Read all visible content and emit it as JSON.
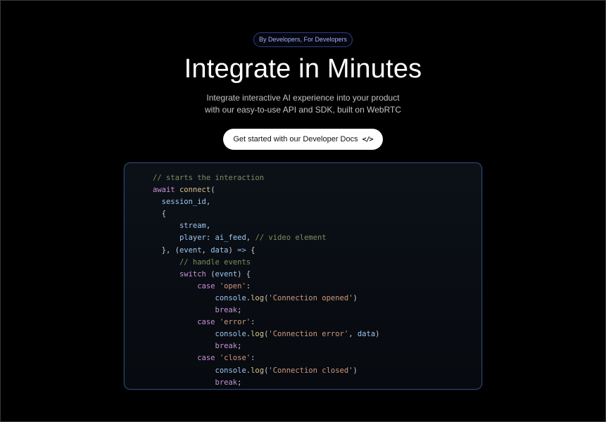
{
  "hero": {
    "badge": "By Developers, For Developers",
    "title": "Integrate in Minutes",
    "subtitle_line1": "Integrate interactive AI experience into your product",
    "subtitle_line2": "with our easy-to-use API and SDK, built on WebRTC",
    "cta_label": "Get started with our Developer Docs",
    "cta_icon": "code-icon"
  },
  "colors": {
    "background": "#000000",
    "badge_border": "#2f3f86",
    "badge_text": "#9fb2ff",
    "cta_background": "#ffffff",
    "code_panel_border": "#2e4a6e",
    "comment": "#7b8f5e",
    "keyword": "#c792d6",
    "string": "#d09a7e",
    "variable": "#9ec7f0"
  },
  "code": {
    "lines": [
      [
        {
          "t": "// starts the interaction",
          "k": "comment"
        }
      ],
      [
        {
          "t": "await ",
          "k": "keyword"
        },
        {
          "t": "connect",
          "k": "fn"
        },
        {
          "t": "(",
          "k": "punc"
        }
      ],
      [
        {
          "t": "  ",
          "k": "punc"
        },
        {
          "t": "session_id",
          "k": "var"
        },
        {
          "t": ",",
          "k": "punc"
        }
      ],
      [
        {
          "t": "  {",
          "k": "punc"
        }
      ],
      [
        {
          "t": "      ",
          "k": "punc"
        },
        {
          "t": "stream",
          "k": "var"
        },
        {
          "t": ",",
          "k": "punc"
        }
      ],
      [
        {
          "t": "      ",
          "k": "punc"
        },
        {
          "t": "player",
          "k": "var"
        },
        {
          "t": ": ",
          "k": "punc"
        },
        {
          "t": "ai_feed",
          "k": "var"
        },
        {
          "t": ", ",
          "k": "punc"
        },
        {
          "t": "// video element",
          "k": "comment"
        }
      ],
      [
        {
          "t": "  }, (",
          "k": "punc"
        },
        {
          "t": "event",
          "k": "var"
        },
        {
          "t": ", ",
          "k": "punc"
        },
        {
          "t": "data",
          "k": "var"
        },
        {
          "t": ") ",
          "k": "punc"
        },
        {
          "t": "=>",
          "k": "op"
        },
        {
          "t": " {",
          "k": "punc"
        }
      ],
      [
        {
          "t": "      ",
          "k": "punc"
        },
        {
          "t": "// handle events",
          "k": "comment"
        }
      ],
      [
        {
          "t": "      ",
          "k": "punc"
        },
        {
          "t": "switch",
          "k": "keyword"
        },
        {
          "t": " (",
          "k": "punc"
        },
        {
          "t": "event",
          "k": "var"
        },
        {
          "t": ") {",
          "k": "punc"
        }
      ],
      [
        {
          "t": "          ",
          "k": "punc"
        },
        {
          "t": "case",
          "k": "keyword"
        },
        {
          "t": " ",
          "k": "punc"
        },
        {
          "t": "'open'",
          "k": "str"
        },
        {
          "t": ":",
          "k": "punc"
        }
      ],
      [
        {
          "t": "              ",
          "k": "punc"
        },
        {
          "t": "console",
          "k": "var"
        },
        {
          "t": ".",
          "k": "punc"
        },
        {
          "t": "log",
          "k": "fn"
        },
        {
          "t": "(",
          "k": "punc"
        },
        {
          "t": "'Connection opened'",
          "k": "str"
        },
        {
          "t": ")",
          "k": "punc"
        }
      ],
      [
        {
          "t": "              ",
          "k": "punc"
        },
        {
          "t": "break",
          "k": "keyword"
        },
        {
          "t": ";",
          "k": "punc"
        }
      ],
      [
        {
          "t": "          ",
          "k": "punc"
        },
        {
          "t": "case",
          "k": "keyword"
        },
        {
          "t": " ",
          "k": "punc"
        },
        {
          "t": "'error'",
          "k": "str"
        },
        {
          "t": ":",
          "k": "punc"
        }
      ],
      [
        {
          "t": "              ",
          "k": "punc"
        },
        {
          "t": "console",
          "k": "var"
        },
        {
          "t": ".",
          "k": "punc"
        },
        {
          "t": "log",
          "k": "fn"
        },
        {
          "t": "(",
          "k": "punc"
        },
        {
          "t": "'Connection error'",
          "k": "str"
        },
        {
          "t": ", ",
          "k": "punc"
        },
        {
          "t": "data",
          "k": "var"
        },
        {
          "t": ")",
          "k": "punc"
        }
      ],
      [
        {
          "t": "              ",
          "k": "punc"
        },
        {
          "t": "break",
          "k": "keyword"
        },
        {
          "t": ";",
          "k": "punc"
        }
      ],
      [
        {
          "t": "          ",
          "k": "punc"
        },
        {
          "t": "case",
          "k": "keyword"
        },
        {
          "t": " ",
          "k": "punc"
        },
        {
          "t": "'close'",
          "k": "str"
        },
        {
          "t": ":",
          "k": "punc"
        }
      ],
      [
        {
          "t": "              ",
          "k": "punc"
        },
        {
          "t": "console",
          "k": "var"
        },
        {
          "t": ".",
          "k": "punc"
        },
        {
          "t": "log",
          "k": "fn"
        },
        {
          "t": "(",
          "k": "punc"
        },
        {
          "t": "'Connection closed'",
          "k": "str"
        },
        {
          "t": ")",
          "k": "punc"
        }
      ],
      [
        {
          "t": "              ",
          "k": "punc"
        },
        {
          "t": "break",
          "k": "keyword"
        },
        {
          "t": ";",
          "k": "punc"
        }
      ]
    ]
  }
}
